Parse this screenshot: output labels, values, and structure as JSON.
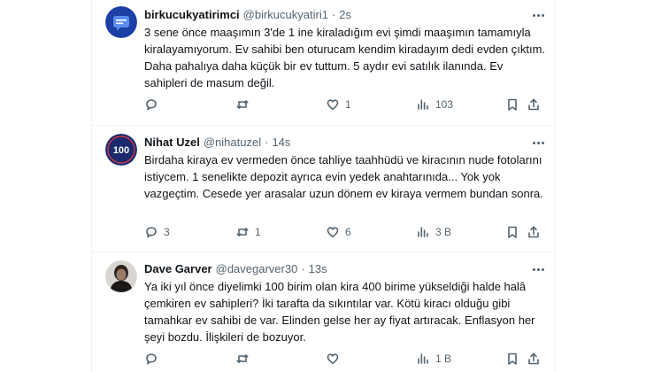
{
  "tweets": [
    {
      "name": "birkucukyatirimci",
      "handle": "@birkucukyatiri1",
      "sep": "·",
      "time": "2s",
      "text": "3 sene önce maaşımın 3'de 1 ine kiraladığım evi şimdi maaşımın tamamıyla kiralayamıyorum. Ev sahibi ben oturucam kendim kiradayım dedi evden çıktım. Daha pahalıya daha küçük bir ev tuttum. 5 aydır evi satılık ilanında. Ev sahipleri de masum değil.",
      "replies": "",
      "retweets": "",
      "likes": "1",
      "views": "103",
      "avatar_icon": "chat-bubble-icon",
      "avatar_color": "#1d3fa6"
    },
    {
      "name": "Nihat Uzel",
      "handle": "@nihatuzel",
      "sep": "·",
      "time": "14s",
      "text": "Birdaha kiraya ev vermeden önce tahliye taahhüdü ve kiracının nude fotolarını istiycem. 1 senelikte depozit ayrıca evin yedek anahtarınıda... Yok yok vazgeçtim. Cesede yer arasalar uzun dönem ev kiraya vermem bundan sonra.",
      "replies": "3",
      "retweets": "1",
      "likes": "6",
      "views": "3 B",
      "avatar_text": "100",
      "avatar_color": "#1a2a6c"
    },
    {
      "name": "Dave Garver",
      "handle": "@davegarver30",
      "sep": "·",
      "time": "13s",
      "text": "Ya iki yıl önce diyelimki 100 birim olan kira 400 birime yükseldiği halde halâ çemkiren ev sahipleri? İki tarafta da sıkıntılar var. Kötü kiracı olduğu gibi tamahkar ev sahibi de var. Elinden gelse her ay fiyat artıracak. Enflasyon her şeyi bozdu. İlişkileri de bozuyor.",
      "replies": "",
      "retweets": "",
      "likes": "",
      "views": "1 B",
      "avatar_icon": "person-photo-icon"
    }
  ],
  "colors": {
    "text": "#0f1419",
    "secondary": "#536471",
    "divider": "#eff3f4"
  }
}
